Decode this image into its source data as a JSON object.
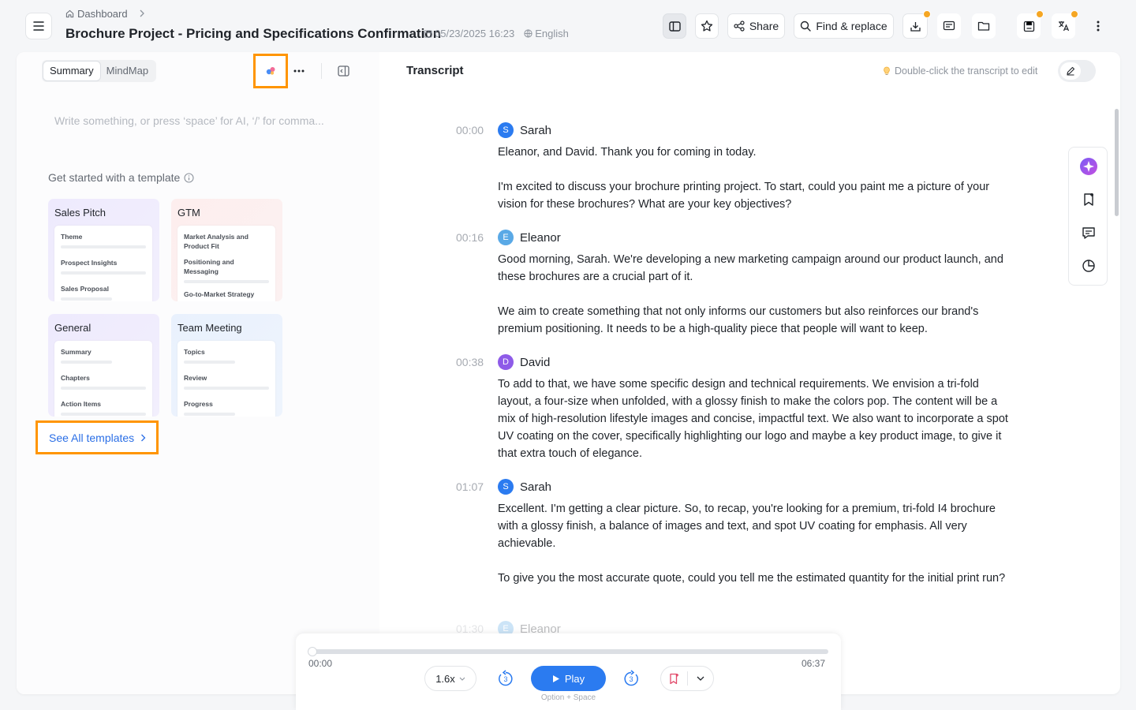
{
  "header": {
    "breadcrumb": "Dashboard",
    "title": "Brochure Project - Pricing and Specifications Confirmation",
    "datetime": "05/23/2025 16:23",
    "language": "English",
    "share_label": "Share",
    "find_replace_label": "Find & replace"
  },
  "summary_panel": {
    "tabs": [
      "Summary",
      "MindMap"
    ],
    "editor_placeholder": "Write something, or press ‘space’ for AI, ‘/’ for comma...",
    "templates_heading": "Get started with a template",
    "templates": [
      {
        "name": "Sales Pitch",
        "rows": [
          "Theme",
          "Prospect Insights",
          "Sales Proposal"
        ]
      },
      {
        "name": "GTM",
        "rows": [
          "Market Analysis and Product Fit",
          "Positioning and Messaging",
          "Go-to-Market Strategy"
        ]
      },
      {
        "name": "General",
        "rows": [
          "Summary",
          "Chapters",
          "Action Items"
        ]
      },
      {
        "name": "Team Meeting",
        "rows": [
          "Topics",
          "Review",
          "Progress"
        ]
      }
    ],
    "see_all_label": "See All templates"
  },
  "transcript": {
    "title": "Transcript",
    "edit_hint": "Double-click the transcript to edit",
    "segments": [
      {
        "time": "00:00",
        "speaker": "Sarah",
        "initial": "S",
        "color": "#2b7bf0",
        "paragraphs": [
          "Eleanor, and David. Thank you for coming in today.",
          "I'm excited to discuss your brochure printing project. To start, could you paint me a picture of your vision for these brochures? What are your key objectives?"
        ]
      },
      {
        "time": "00:16",
        "speaker": "Eleanor",
        "initial": "E",
        "color": "#5aa9e6",
        "paragraphs": [
          "Good morning, Sarah. We're developing a new marketing campaign around our product launch, and these brochures are a crucial part of it.",
          "We aim to create something that not only informs our customers but also reinforces our brand's premium positioning. It needs to be a high-quality piece that people will want to keep."
        ]
      },
      {
        "time": "00:38",
        "speaker": "David",
        "initial": "D",
        "color": "#8e5be8",
        "paragraphs": [
          "To add to that, we have some specific design and technical requirements. We envision a tri-fold layout, a four-size when unfolded, with a glossy finish to make the colors pop. The content will be a mix of high-resolution lifestyle images and concise, impactful text. We also want to incorporate a spot UV coating on the cover, specifically highlighting our logo and maybe a key product image, to give it that extra touch of elegance."
        ]
      },
      {
        "time": "01:07",
        "speaker": "Sarah",
        "initial": "S",
        "color": "#2b7bf0",
        "paragraphs": [
          "Excellent. I'm getting a clear picture. So, to recap, you're looking for a premium, tri-fold I4 brochure with a glossy finish, a balance of images and text, and spot UV coating for emphasis. All very achievable.",
          "To give you the most accurate quote, could you tell me the estimated quantity for the initial print run?"
        ]
      },
      {
        "time": "01:30",
        "speaker": "Eleanor",
        "initial": "E",
        "color": "#5aa9e6",
        "paragraphs": []
      }
    ]
  },
  "player": {
    "current_time": "00:00",
    "duration": "06:37",
    "progress": 0,
    "speed": "1.6x",
    "skip_back": "3",
    "skip_forward": "3",
    "play_label": "Play",
    "play_hint": "Option + Space"
  }
}
